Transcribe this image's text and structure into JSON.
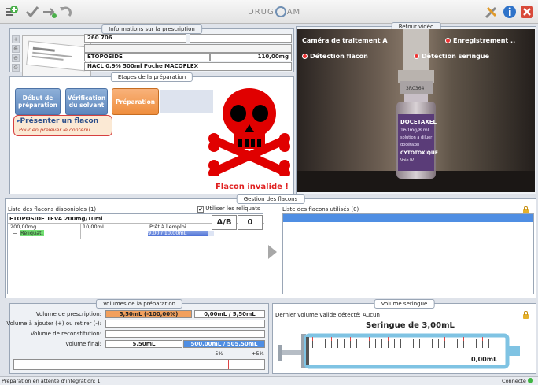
{
  "toolbar": {
    "brand": "DRUG",
    "brand_suffix": "AM"
  },
  "prescription": {
    "title": "Informations sur la prescription",
    "number": "260 706",
    "drug": "ETOPOSIDE",
    "dose": "110,00mg",
    "container": "NACL 0,9% 500ml Poche MACOFLEX",
    "label_card_text": "ETOPOSIDE"
  },
  "steps": {
    "title": "Etapes de la préparation",
    "items": [
      {
        "label": "Début de préparation"
      },
      {
        "label": "Vérification du solvant"
      },
      {
        "label": "Préparation"
      }
    ],
    "instruction": "Présenter un flacon",
    "sub_instruction": "Pour en prélever le contenu",
    "alert": "Flacon invalide !"
  },
  "video": {
    "title": "Retour vidéo",
    "camera": "Caméra de traitement A",
    "recording": "Enregistrement ..",
    "detect_vial": "Détection flacon",
    "detect_syringe": "Détection seringue",
    "vial_label_lines": [
      "DOCETAXEL",
      "160mg/8 ml",
      "solution à diluer",
      "docétaxel",
      "CYTOTOXIQUE",
      "Voie IV"
    ],
    "cap_label": "3RC364"
  },
  "flacons": {
    "title": "Gestion des flacons",
    "available_title": "Liste des flacons disponibles (1)",
    "use_remainders": "Utiliser les reliquats",
    "used_title": "Liste des flacons utilisés (0)",
    "row": {
      "name": "ETOPOSIDE TEVA 200mg/10ml",
      "dose": "200,00mg",
      "volume": "10,00mL",
      "status": "Prêt à l'emploi",
      "reliquat_label": "Reliquat",
      "reliquat_value": "9,00 / 10,00mL",
      "reliquat_fraction": 0.9
    },
    "ab_label": "A/B",
    "ab_value": "0"
  },
  "volumes": {
    "title": "Volumes de la préparation",
    "prescription_label": "Volume de prescription:",
    "prescription_value": "5,50mL (-100,00%)",
    "prescription_value2": "0,00mL / 5,50mL",
    "adjust_label": "Volume à ajouter (+) ou retirer (-):",
    "reconstitution_label": "Volume de reconstitution:",
    "final_label": "Volume final:",
    "final_value": "5,50mL",
    "final_value2": "500,00mL / 505,50mL",
    "minus_label": "-5%",
    "plus_label": "+5%"
  },
  "syringe": {
    "title": "Volume seringue",
    "last_volume": "Dernier volume valide détecté: Aucun",
    "name": "Seringue de 3,00mL",
    "value": "0,00mL"
  },
  "status": {
    "left": "Préparation en attente d'intégration: 1",
    "right": "Connecté"
  },
  "colors": {
    "accent_orange": "#f2a05d",
    "accent_blue": "#4f8ee3",
    "alert_red": "#e02020"
  }
}
